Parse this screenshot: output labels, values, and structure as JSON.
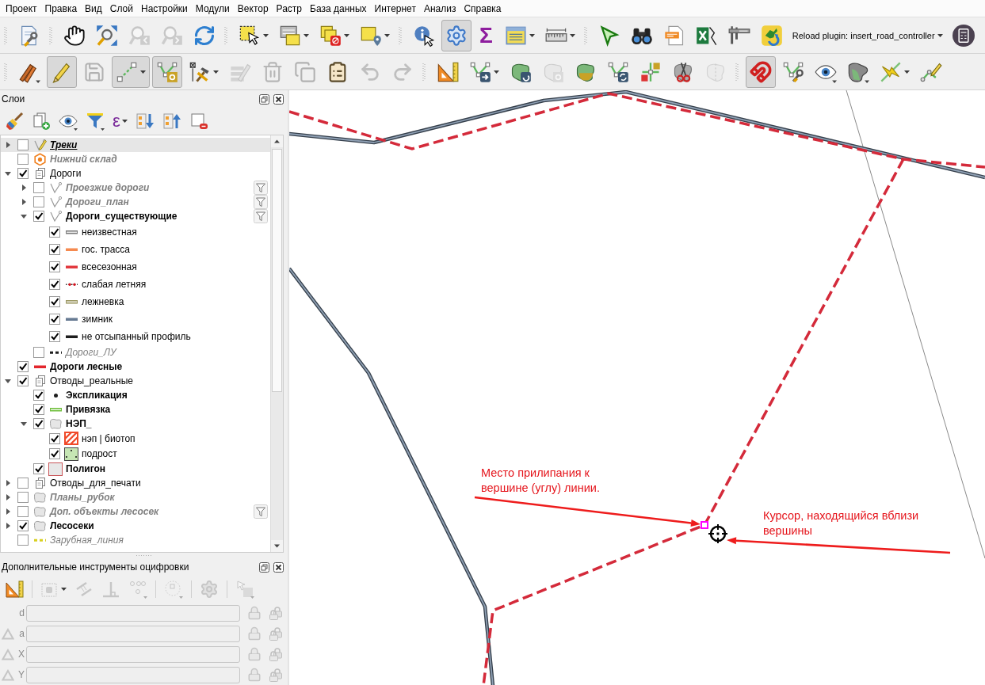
{
  "menu_bar": [
    "Проект",
    "Правка",
    "Вид",
    "Слой",
    "Настройки",
    "Модули",
    "Вектор",
    "Растр",
    "База данных",
    "Интернет",
    "Анализ",
    "Справка"
  ],
  "toolbars": [
    {
      "buttons": [
        {
          "pressed": false,
          "disabled": false
        },
        {
          "pressed": false,
          "disabled": false
        },
        {
          "pressed": false,
          "disabled": false
        },
        {
          "pressed": false,
          "disabled": true
        },
        {
          "pressed": false,
          "disabled": true
        },
        {
          "pressed": false,
          "disabled": false
        },
        {
          "pressed": false,
          "disabled": false
        },
        {
          "pressed": false,
          "disabled": false
        },
        {
          "pressed": false,
          "disabled": false
        },
        {
          "pressed": false,
          "disabled": false
        },
        {
          "pressed": false,
          "disabled": false
        },
        {
          "pressed": true,
          "disabled": false
        },
        {
          "label": "Σ",
          "pressed": false,
          "disabled": false
        },
        {
          "pressed": false,
          "disabled": false
        },
        {
          "pressed": false,
          "disabled": false
        },
        {
          "pressed": false,
          "disabled": false
        },
        {
          "pressed": false,
          "disabled": false
        },
        {
          "pressed": false,
          "disabled": false
        },
        {
          "pressed": false,
          "disabled": false
        },
        {
          "pressed": false,
          "disabled": false
        },
        {
          "pressed": false,
          "disabled": false
        },
        {
          "label": "Reload plugin: insert_road_controller",
          "pressed": false,
          "disabled": false
        },
        {
          "pressed": false,
          "disabled": false
        }
      ]
    },
    {
      "buttons": [
        {
          "pressed": false,
          "disabled": false
        },
        {
          "pressed": true,
          "disabled": false
        },
        {
          "pressed": false,
          "disabled": true
        },
        {
          "pressed": true,
          "disabled": false
        },
        {
          "pressed": true,
          "disabled": false
        },
        {
          "pressed": false,
          "disabled": false
        },
        {
          "pressed": false,
          "disabled": true
        },
        {
          "pressed": false,
          "disabled": true
        },
        {
          "pressed": false,
          "disabled": true
        },
        {
          "pressed": false,
          "disabled": false
        },
        {
          "pressed": false,
          "disabled": true
        },
        {
          "pressed": false,
          "disabled": true
        },
        {
          "pressed": false,
          "disabled": false
        },
        {
          "pressed": false,
          "disabled": false
        },
        {
          "pressed": false,
          "disabled": false
        },
        {
          "pressed": false,
          "disabled": true
        },
        {
          "pressed": false,
          "disabled": false
        },
        {
          "pressed": false,
          "disabled": false
        },
        {
          "pressed": false,
          "disabled": false
        },
        {
          "pressed": false,
          "disabled": false
        },
        {
          "pressed": false,
          "disabled": true
        },
        {
          "pressed": true,
          "disabled": false
        },
        {
          "pressed": false,
          "disabled": false
        },
        {
          "pressed": false,
          "disabled": false
        },
        {
          "pressed": false,
          "disabled": false
        },
        {
          "pressed": false,
          "disabled": false
        },
        {
          "pressed": false,
          "disabled": false
        }
      ]
    }
  ],
  "layers_panel": {
    "title": "Слои",
    "expression_button": {
      "label": "ε"
    },
    "tree": [
      {
        "label": "Треки",
        "kind": "line_layer",
        "checked": false,
        "expanded": false,
        "selected": true,
        "emphasized": true,
        "editing": true,
        "filtered": false
      },
      {
        "label": "Нижний склад",
        "kind": "point_layer",
        "checked": false,
        "selected": false,
        "emphasized": true,
        "editing": false,
        "filtered": false
      },
      {
        "label": "Дороги",
        "kind": "group",
        "checked": true,
        "expanded": true,
        "selected": false,
        "emphasized": false,
        "editing": false,
        "filtered": false,
        "children": [
          {
            "label": "Проезжие дороги",
            "kind": "line_layer",
            "checked": false,
            "expanded": false,
            "selected": false,
            "emphasized": true,
            "editing": false,
            "filtered": true
          },
          {
            "label": "Дороги_план",
            "kind": "line_layer",
            "checked": false,
            "expanded": false,
            "selected": false,
            "emphasized": true,
            "editing": false,
            "filtered": true
          },
          {
            "label": "Дороги_существующие",
            "kind": "line_layer",
            "checked": true,
            "expanded": true,
            "selected": false,
            "emphasized": true,
            "editing": false,
            "filtered": true,
            "children": [
              {
                "label": "неизвестная",
                "kind": "double_line",
                "color": "#7a7a7a",
                "checked": true,
                "selected": false,
                "emphasized": false,
                "editing": false,
                "filtered": false
              },
              {
                "label": "гос. трасса",
                "kind": "line",
                "color": "#f58a50",
                "checked": true,
                "selected": false,
                "emphasized": false,
                "editing": false,
                "filtered": false
              },
              {
                "label": "всесезонная",
                "kind": "line",
                "color": "#e23a3f",
                "checked": true,
                "selected": false,
                "emphasized": false,
                "editing": false,
                "filtered": false
              },
              {
                "label": "слабая летняя",
                "kind": "dotted_line",
                "color": "#d0141e",
                "checked": true,
                "selected": false,
                "emphasized": false,
                "editing": false,
                "filtered": false
              },
              {
                "label": "лежневка",
                "kind": "double_line",
                "color": "#9a9660",
                "checked": true,
                "selected": false,
                "emphasized": false,
                "editing": false,
                "filtered": false
              },
              {
                "label": "зимник",
                "kind": "line",
                "color": "#667a92",
                "checked": true,
                "selected": false,
                "emphasized": false,
                "editing": false,
                "filtered": false
              },
              {
                "label": "не отсыпанный профиль",
                "kind": "line",
                "color": "#1e1e1e",
                "checked": true,
                "selected": false,
                "emphasized": false,
                "editing": false,
                "filtered": false
              }
            ]
          },
          {
            "label": "Дороги_ЛУ",
            "kind": "dashed_line",
            "color": "#1e1e1e",
            "checked": false,
            "selected": false,
            "emphasized": false,
            "editing": false,
            "filtered": false
          }
        ]
      },
      {
        "label": "Дороги лесные",
        "kind": "line",
        "color": "#e3262d",
        "checked": true,
        "selected": false,
        "emphasized": true,
        "editing": false,
        "filtered": false
      },
      {
        "label": "Отводы_реальные",
        "kind": "group",
        "checked": true,
        "expanded": true,
        "selected": false,
        "emphasized": false,
        "editing": false,
        "filtered": false,
        "children": [
          {
            "label": "Экспликация",
            "kind": "point",
            "color": "#1e1e1e",
            "checked": true,
            "selected": false,
            "emphasized": true,
            "editing": false,
            "filtered": false
          },
          {
            "label": "Привязка",
            "kind": "double_line",
            "color": "#6fbf3c",
            "checked": true,
            "selected": false,
            "emphasized": true,
            "editing": false,
            "filtered": false
          },
          {
            "label": "НЭП_",
            "kind": "polygon_layer",
            "checked": true,
            "expanded": true,
            "selected": false,
            "emphasized": true,
            "editing": false,
            "filtered": false,
            "children": [
              {
                "label": "нэп | биотоп",
                "kind": "hatch",
                "color": "#f04a2a",
                "checked": true,
                "selected": false,
                "emphasized": false,
                "editing": false,
                "filtered": false
              },
              {
                "label": "подрост",
                "kind": "dotted_fill",
                "color": "#c6e6b4",
                "checked": true,
                "selected": false,
                "emphasized": false,
                "editing": false,
                "filtered": false
              }
            ]
          },
          {
            "label": "Полигон",
            "kind": "fill",
            "color": "#e8e8e8",
            "checked": true,
            "selected": false,
            "emphasized": true,
            "editing": false,
            "filtered": false
          }
        ]
      },
      {
        "label": "Отводы_для_печати",
        "kind": "group",
        "checked": false,
        "expanded": false,
        "selected": false,
        "emphasized": false,
        "editing": false,
        "filtered": false
      },
      {
        "label": "Планы_рубок",
        "kind": "polygon_layer",
        "checked": false,
        "expanded": false,
        "selected": false,
        "emphasized": true,
        "editing": false,
        "filtered": false
      },
      {
        "label": "Доп. объекты лесосек",
        "kind": "polygon_layer",
        "checked": false,
        "expanded": false,
        "selected": false,
        "emphasized": true,
        "editing": false,
        "filtered": true
      },
      {
        "label": "Лесосеки",
        "kind": "polygon_layer",
        "checked": true,
        "expanded": false,
        "selected": false,
        "emphasized": true,
        "editing": false,
        "filtered": false
      },
      {
        "label": "Зарубная_линия",
        "kind": "dashed_line",
        "color": "#d8d020",
        "checked": false,
        "selected": false,
        "emphasized": false,
        "editing": false,
        "filtered": false
      }
    ]
  },
  "digitizing_panel": {
    "title": "Дополнительные инструменты оцифровки",
    "toolbar": [
      {
        "disabled": false
      },
      {
        "disabled": true
      },
      {
        "disabled": true
      },
      {
        "disabled": true
      },
      {
        "disabled": true
      },
      {
        "disabled": true
      },
      {
        "disabled": true
      },
      {
        "disabled": true
      }
    ],
    "fields": [
      {
        "label": "d",
        "kind": "plain",
        "disabled": true
      },
      {
        "label": "a",
        "kind": "relative",
        "disabled": true
      },
      {
        "label": "X",
        "kind": "relative",
        "disabled": true
      },
      {
        "label": "Y",
        "kind": "relative",
        "disabled": true
      }
    ]
  },
  "map": {
    "annotations": [
      {
        "text": "Место прилипания к\nвершине (углу) линии."
      },
      {
        "text": "Курсор, находящийся вблизи\nвершины"
      }
    ]
  }
}
